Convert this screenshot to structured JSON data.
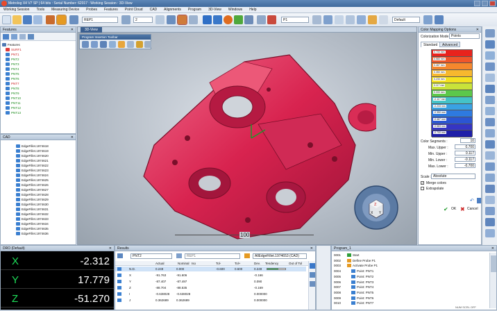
{
  "window": {
    "title": "Metrolog X4 V7 SP | 64 bits : Serial Number: 62017 : Working Session : 3D-View"
  },
  "menu": [
    "Working Session",
    "Tools",
    "Measuring Device",
    "Probes",
    "Features",
    "Point Cloud",
    "CAD",
    "Alignments",
    "Program",
    "3D-View",
    "Windows",
    "Help"
  ],
  "toolbar": {
    "probe_combo": "REP1",
    "sensor_value": "2",
    "point_combo": "P1",
    "default_combo": "Default"
  },
  "features_panel": {
    "title": "Features",
    "root": "Features",
    "items": [
      "SURF1",
      "PNT1",
      "PNT2",
      "PNT3",
      "PNT4",
      "PNT5",
      "PNT6",
      "PNT7",
      "PNT8",
      "PNT9",
      "PNT10",
      "PNT11",
      "PNT12",
      "PNT13"
    ]
  },
  "cad_panel": {
    "title": "CAD",
    "items": [
      "EdgeFillet.1974618",
      "EdgeFillet.1974619",
      "EdgeFillet.1974620",
      "EdgeFillet.1974621",
      "EdgeFillet.1974622",
      "EdgeFillet.1974623",
      "EdgeFillet.1974624",
      "EdgeFillet.1974625",
      "EdgeFillet.1974626",
      "EdgeFillet.1974627",
      "EdgeFillet.1974628",
      "EdgeFillet.1974629",
      "EdgeFillet.1974630",
      "EdgeFillet.1974631",
      "EdgeFillet.1974632",
      "EdgeFillet.1974633",
      "EdgeFillet.1974634",
      "EdgeFillet.1974635",
      "EdgeFillet.1974636"
    ]
  },
  "view3d": {
    "tab": "3D-View",
    "toolbar_title": "Program Insertion Toolbar",
    "scale_label": "100"
  },
  "color_panel": {
    "title": "Color Mapping Options",
    "mode_label": "Colorization Mode :",
    "mode_value": "Points",
    "tabs": [
      "Standard",
      "Advanced"
    ],
    "legend": [
      "0.700 mm",
      "0.583 mm",
      "0.467 mm",
      "0.350 mm",
      "0.233 mm",
      "0.117 mm",
      "0.000 mm",
      "-0.117 mm",
      "-0.233 mm",
      "-0.350 mm",
      "-0.467 mm",
      "-0.583 mm",
      "-0.700 mm"
    ],
    "legend_colors": [
      "#e8231d",
      "#f0562a",
      "#f5872d",
      "#f7b82e",
      "#f5e21f",
      "#c9e33a",
      "#5cc84a",
      "#44c3c8",
      "#3aa2e3",
      "#2e7ae0",
      "#2b55d3",
      "#3535c4",
      "#1f1fa8"
    ],
    "segments_label": "Color Segments :",
    "segments_value": "10",
    "max_upper_label": "Max. Upper :",
    "max_upper_value": "0.700",
    "min_upper_label": "Min. Upper :",
    "min_upper_value": "0.117",
    "min_lower_label": "Min. Lower :",
    "min_lower_value": "-0.117",
    "max_lower_label": "Max. Lower :",
    "max_lower_value": "-0.700",
    "scale_label": "Scale :",
    "scale_value": "Absolute",
    "merge_label": "Merge colors",
    "extrapolate_label": "Extrapolate",
    "ok_label": "OK",
    "cancel_label": "Cancel"
  },
  "dro": {
    "title": "DRO (Default)",
    "rows": [
      {
        "axis": "X",
        "value": "-2.312"
      },
      {
        "axis": "Y",
        "value": "17.779"
      },
      {
        "axis": "Z",
        "value": "-51.270"
      }
    ]
  },
  "results": {
    "title": "Results",
    "feature": "PNT2",
    "ref": "REP1",
    "cad": "AllEdgeFillet.1974653 (CAD)",
    "headers": [
      "Actual",
      "Nominal",
      "Iso",
      "Tol-",
      "Tol+",
      "Dev.",
      "Tendency",
      "Out of Tol"
    ],
    "rows": [
      {
        "label": "N.D.",
        "actual": "0.249",
        "nominal": "0.000",
        "tolm": "-0.600",
        "tolp": "0.600",
        "dev": "0.249"
      },
      {
        "label": "X",
        "actual": "-91.763",
        "nominal": "-91.606",
        "tolm": "",
        "tolp": "",
        "dev": "-0.166"
      },
      {
        "label": "Y",
        "actual": "-87.407",
        "nominal": "-87.497",
        "tolm": "",
        "tolp": "",
        "dev": "0.090"
      },
      {
        "label": "Z",
        "actual": "-88.704",
        "nominal": "-88.535",
        "tolm": "",
        "tolp": "",
        "dev": "-0.169"
      },
      {
        "label": "I",
        "actual": "-0.638028",
        "nominal": "-0.638028",
        "tolm": "",
        "tolp": "",
        "dev": "0.000000"
      },
      {
        "label": "J",
        "actual": "0.362689",
        "nominal": "0.362689",
        "tolm": "",
        "tolp": "",
        "dev": "0.000000"
      }
    ]
  },
  "program": {
    "title": "Program_1",
    "rows": [
      {
        "n": "0001",
        "t": "Start"
      },
      {
        "n": "0002",
        "t": "Define Probe P1"
      },
      {
        "n": "0003",
        "t": "Activate Probe P1"
      },
      {
        "n": "0004",
        "t": "Point: PNT1"
      },
      {
        "n": "0005",
        "t": "Point: PNT2"
      },
      {
        "n": "0006",
        "t": "Point: PNT3"
      },
      {
        "n": "0007",
        "t": "Point: PNT4"
      },
      {
        "n": "0008",
        "t": "Point: PNT5"
      },
      {
        "n": "0009",
        "t": "Point: PNT6"
      },
      {
        "n": "0010",
        "t": "Point: PNT7"
      }
    ]
  },
  "status": {
    "caps": "NUM SCRL OFF"
  }
}
